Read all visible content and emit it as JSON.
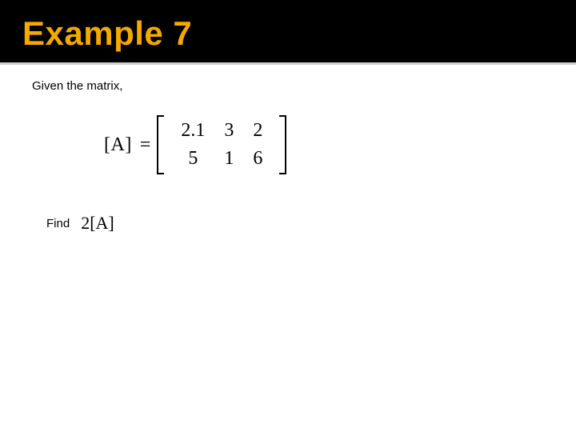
{
  "title": "Example 7",
  "given_text": "Given the matrix,",
  "lhs": "[A]",
  "equals": "=",
  "matrix": {
    "rows": [
      [
        "2.1",
        "3",
        "2"
      ],
      [
        "5",
        "1",
        "6"
      ]
    ]
  },
  "find_label": "Find",
  "find_expr": "2[A]"
}
